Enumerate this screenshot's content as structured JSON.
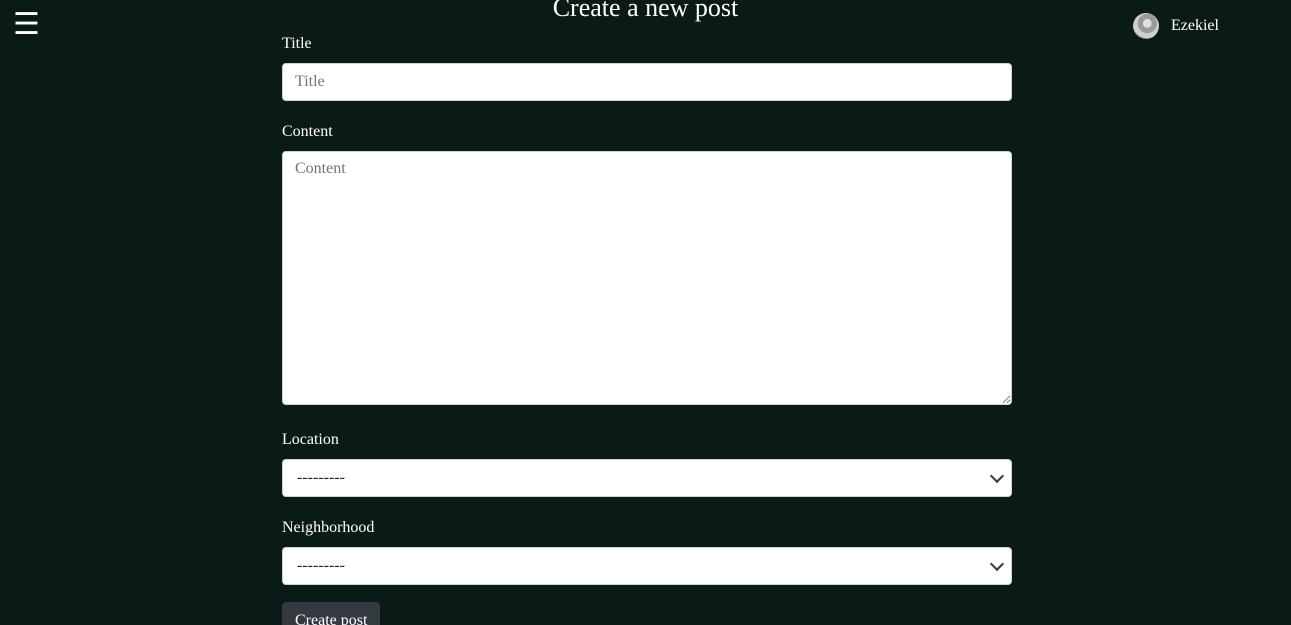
{
  "header": {
    "menu_icon": "☰",
    "title": "Create a new post",
    "user": {
      "name": "Ezekiel",
      "avatar_icon": "avatar"
    }
  },
  "form": {
    "title": {
      "label": "Title",
      "placeholder": "Title",
      "value": ""
    },
    "content": {
      "label": "Content",
      "placeholder": "Content",
      "value": ""
    },
    "location": {
      "label": "Location",
      "selected": "---------"
    },
    "neighborhood": {
      "label": "Neighborhood",
      "selected": "---------"
    },
    "submit_label": "Create post"
  },
  "colors": {
    "background": "#0a1a16",
    "button": "#343a40",
    "text": "#ffffff"
  }
}
